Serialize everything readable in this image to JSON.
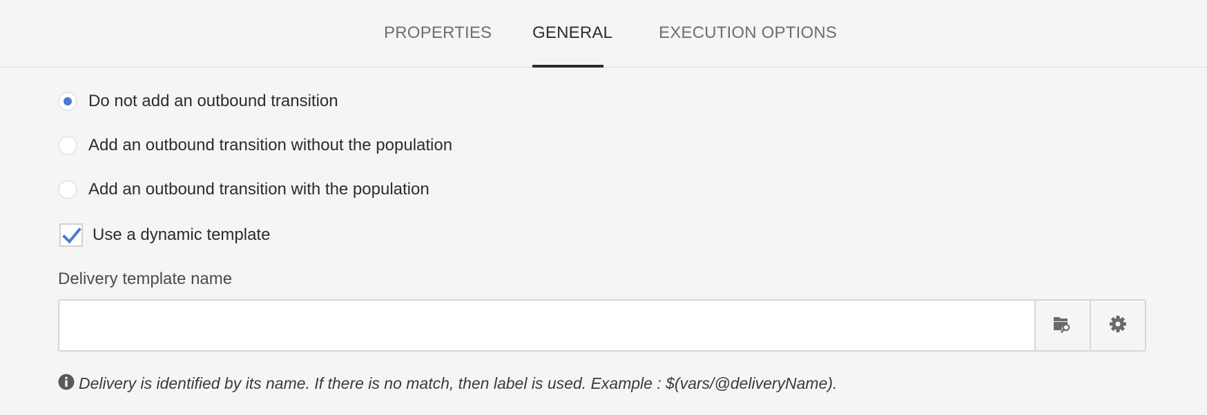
{
  "tabs": [
    {
      "label": "PROPERTIES",
      "active": false
    },
    {
      "label": "GENERAL",
      "active": true
    },
    {
      "label": "EXECUTION OPTIONS",
      "active": false
    }
  ],
  "transition_options": [
    {
      "label": "Do not add an outbound transition",
      "checked": true
    },
    {
      "label": "Add an outbound transition without the population",
      "checked": false
    },
    {
      "label": "Add an outbound transition with the population",
      "checked": false
    }
  ],
  "dynamic_template": {
    "label": "Use a dynamic template",
    "checked": true
  },
  "delivery_template": {
    "label": "Delivery template name",
    "value": "",
    "placeholder": "",
    "browse_icon": "folder-search-icon",
    "settings_icon": "gear-icon"
  },
  "help": {
    "icon": "info-icon",
    "text": "Delivery is identified by its name. If there is no match, then label is used. Example : $(vars/@deliveryName)."
  },
  "colors": {
    "accent": "#4a7bd0",
    "background": "#f5f5f5",
    "text": "#2c2c2c",
    "tab_inactive": "#6e6e6e"
  }
}
